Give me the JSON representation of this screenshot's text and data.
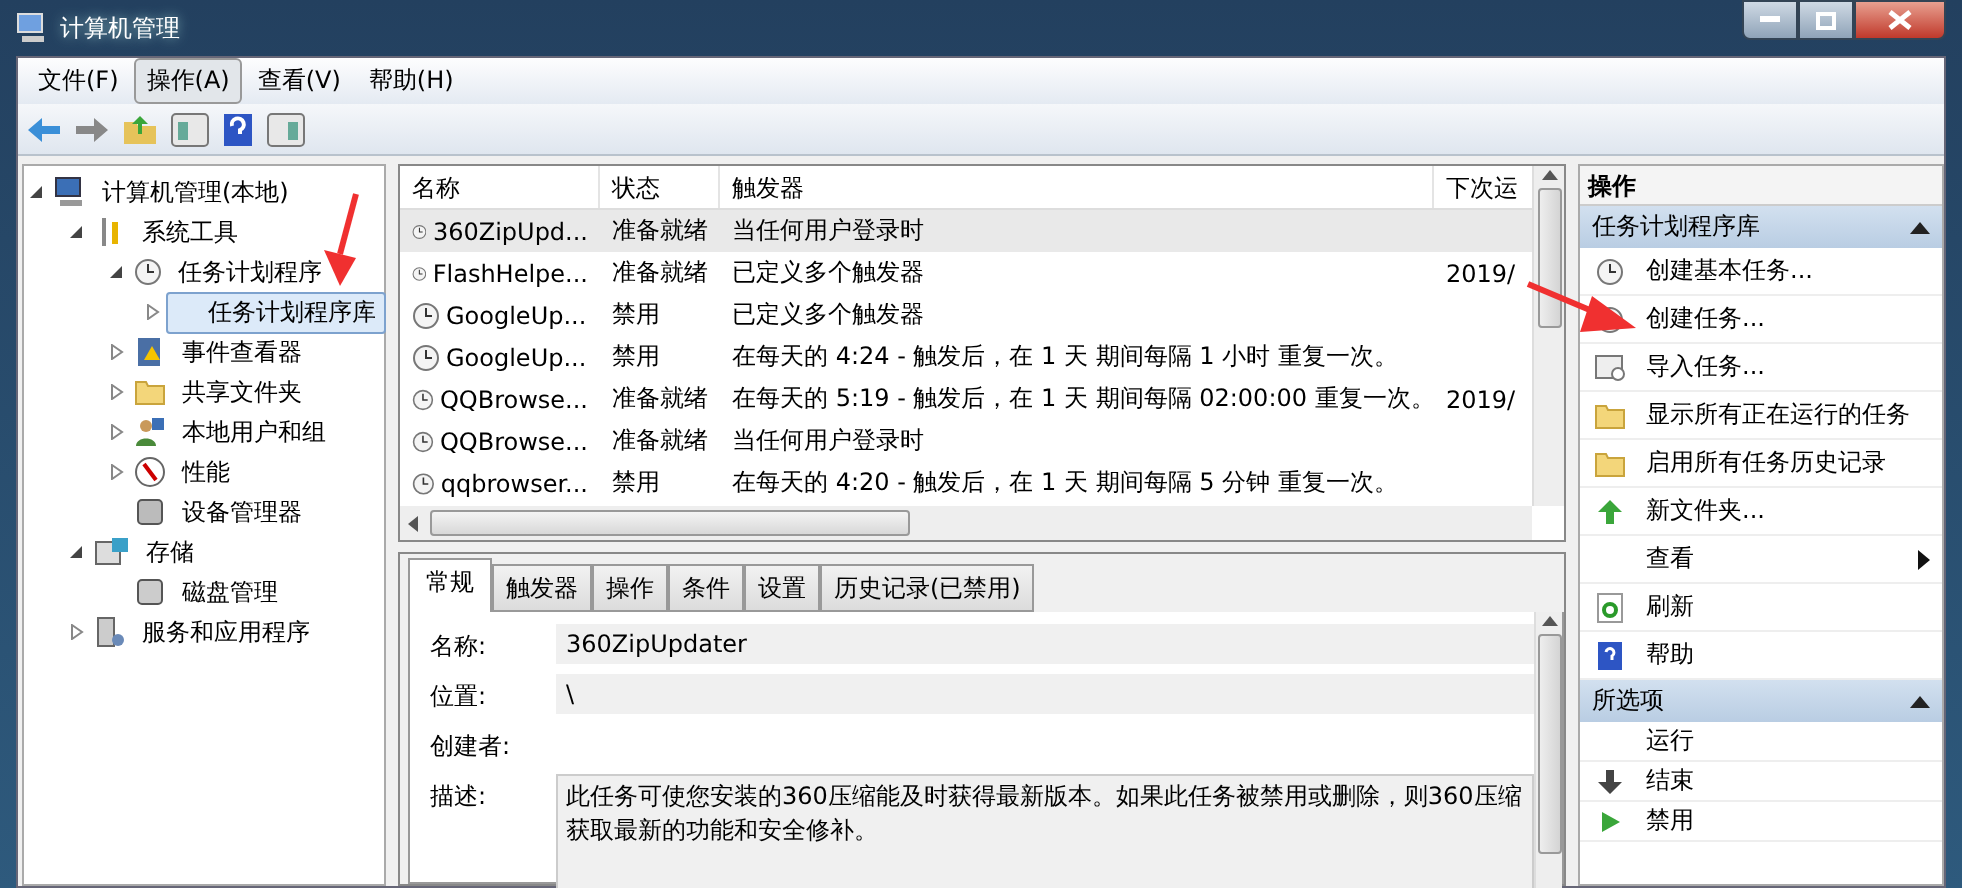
{
  "window": {
    "title": "计算机管理"
  },
  "menu": [
    {
      "label": "文件(F)",
      "selected": false
    },
    {
      "label": "操作(A)",
      "selected": true
    },
    {
      "label": "查看(V)",
      "selected": false
    },
    {
      "label": "帮助(H)",
      "selected": false
    }
  ],
  "tree": [
    {
      "label": "计算机管理(本地)",
      "expanded": true,
      "selected": false,
      "children": [
        {
          "label": "系统工具",
          "expanded": true,
          "selected": false,
          "children": [
            {
              "label": "任务计划程序",
              "expanded": true,
              "selected": false,
              "children": [
                {
                  "label": "任务计划程序库",
                  "expanded": false,
                  "selected": true
                }
              ]
            },
            {
              "label": "事件查看器",
              "expanded": false,
              "selected": false
            },
            {
              "label": "共享文件夹",
              "expanded": false,
              "selected": false
            },
            {
              "label": "本地用户和组",
              "expanded": false,
              "selected": false
            },
            {
              "label": "性能",
              "expanded": false,
              "selected": false
            },
            {
              "label": "设备管理器",
              "selected": false
            }
          ]
        },
        {
          "label": "存储",
          "expanded": true,
          "selected": false,
          "children": [
            {
              "label": "磁盘管理",
              "selected": false
            }
          ]
        },
        {
          "label": "服务和应用程序",
          "expanded": false,
          "selected": false
        }
      ]
    }
  ],
  "table": {
    "columns": [
      "名称",
      "状态",
      "触发器",
      "下次运"
    ],
    "rows": [
      {
        "name": "360ZipUpd...",
        "status": "准备就绪",
        "trigger": "当任何用户登录时",
        "next": "",
        "selected": true
      },
      {
        "name": "FlashHelpe...",
        "status": "准备就绪",
        "trigger": "已定义多个触发器",
        "next": "2019/",
        "selected": false
      },
      {
        "name": "GoogleUp...",
        "status": "禁用",
        "trigger": "已定义多个触发器",
        "next": "",
        "selected": false
      },
      {
        "name": "GoogleUp...",
        "status": "禁用",
        "trigger": "在每天的 4:24 - 触发后，在 1 天 期间每隔 1 小时 重复一次。",
        "next": "",
        "selected": false
      },
      {
        "name": "QQBrowse...",
        "status": "准备就绪",
        "trigger": "在每天的 5:19 - 触发后，在 1 天 期间每隔 02:00:00 重复一次。",
        "next": "2019/",
        "selected": false
      },
      {
        "name": "QQBrowse...",
        "status": "准备就绪",
        "trigger": "当任何用户登录时",
        "next": "",
        "selected": false
      },
      {
        "name": "qqbrowser...",
        "status": "禁用",
        "trigger": "在每天的 4:20 - 触发后，在 1 天 期间每隔 5 分钟 重复一次。",
        "next": "",
        "selected": false
      }
    ]
  },
  "tabs": [
    {
      "label": "常规",
      "selected": true
    },
    {
      "label": "触发器",
      "selected": false
    },
    {
      "label": "操作",
      "selected": false
    },
    {
      "label": "条件",
      "selected": false
    },
    {
      "label": "设置",
      "selected": false
    },
    {
      "label": "历史记录(已禁用)",
      "selected": false
    }
  ],
  "details": {
    "fields": [
      {
        "label": "名称:",
        "value": "360ZipUpdater",
        "kind": "field"
      },
      {
        "label": "位置:",
        "value": "\\",
        "kind": "field"
      },
      {
        "label": "创建者:",
        "kind": "plain"
      },
      {
        "label": "描述:",
        "lines": [
          "此任务可使您安装的360压缩能及时获得最新版本。如果此任务被禁用或删除，则360压缩",
          "获取最新的功能和安全修补。"
        ],
        "kind": "area"
      }
    ]
  },
  "actions": {
    "title": "操作",
    "sections": [
      {
        "title": "任务计划程序库",
        "expanded": true,
        "items": [
          {
            "label": "创建基本任务...",
            "kind": "item"
          },
          {
            "label": "创建任务...",
            "kind": "item"
          },
          {
            "label": "导入任务...",
            "kind": "item"
          },
          {
            "label": "显示所有正在运行的任务",
            "kind": "item"
          },
          {
            "label": "启用所有任务历史记录",
            "kind": "item"
          },
          {
            "label": "新文件夹...",
            "kind": "item"
          },
          {
            "label": "查看",
            "kind": "submenu"
          },
          {
            "label": "刷新",
            "kind": "item"
          },
          {
            "label": "帮助",
            "kind": "item"
          }
        ]
      },
      {
        "title": "所选项",
        "expanded": true,
        "items": [
          {
            "label": "运行",
            "kind": "item"
          },
          {
            "label": "结束",
            "kind": "item"
          },
          {
            "label": "禁用",
            "kind": "item"
          }
        ]
      }
    ]
  }
}
